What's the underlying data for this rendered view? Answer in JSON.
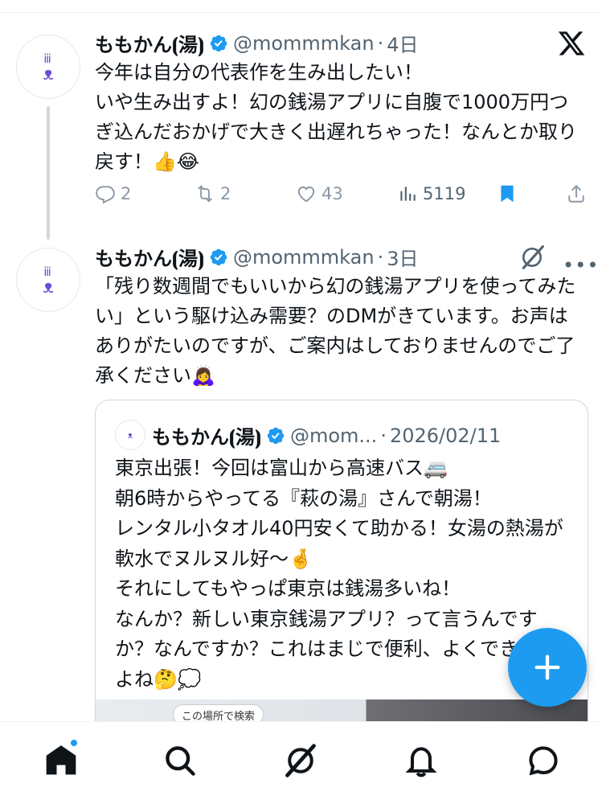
{
  "tweet1": {
    "display_name": "ももかん⦗湯⦘",
    "handle": "@mommmkan",
    "separator": "·",
    "time": "4日",
    "text": "今年は自分の代表作を生み出したい！\nいや生み出すよ！幻の銭湯アプリに自腹で1000万円つぎ込んだおかげで大きく出遅れちゃった！なんとか取り戻す！👍😂",
    "replies": "2",
    "reposts": "2",
    "likes": "43",
    "views": "5119"
  },
  "tweet2": {
    "display_name": "ももかん⦗湯⦘",
    "handle": "@mommmkan",
    "separator": "·",
    "time": "3日",
    "more": "•••",
    "text": "「残り数週間でもいいから幻の銭湯アプリを使ってみたい」という駆け込み需要？のDMがきています。お声はありがたいのですが、ご案内はしておりませんのでご了承ください🙇‍♀️"
  },
  "quote": {
    "display_name": "ももかん⦗湯⦘",
    "handle": "@mom...",
    "separator": "·",
    "date": "2026/02/11",
    "text": "東京出張！今回は富山から高速バス🚐\n朝6時からやってる『萩の湯』さんで朝湯！\nレンタル小タオル40円安くて助かる！女湯の熱湯が軟水でヌルヌル好〜🤞\nそれにしてもやっぱ東京は銭湯多いね！\nなんか？新しい東京銭湯アプリ？って言うんですか？なんですか？これはまじで便利、よくできとるよね🤔💭",
    "map_chip": "この場所で検索"
  },
  "icons": {
    "x_logo": "x-logo-icon",
    "grok": "grok-icon",
    "verified": "verified-badge-icon",
    "compose": "plus-icon",
    "nav": [
      "home-icon",
      "search-icon",
      "grok-icon",
      "bell-icon",
      "messages-icon"
    ]
  },
  "colors": {
    "accent": "#1d9bf0",
    "text": "#0f1419",
    "muted": "#536471",
    "border": "#cfd9de"
  }
}
